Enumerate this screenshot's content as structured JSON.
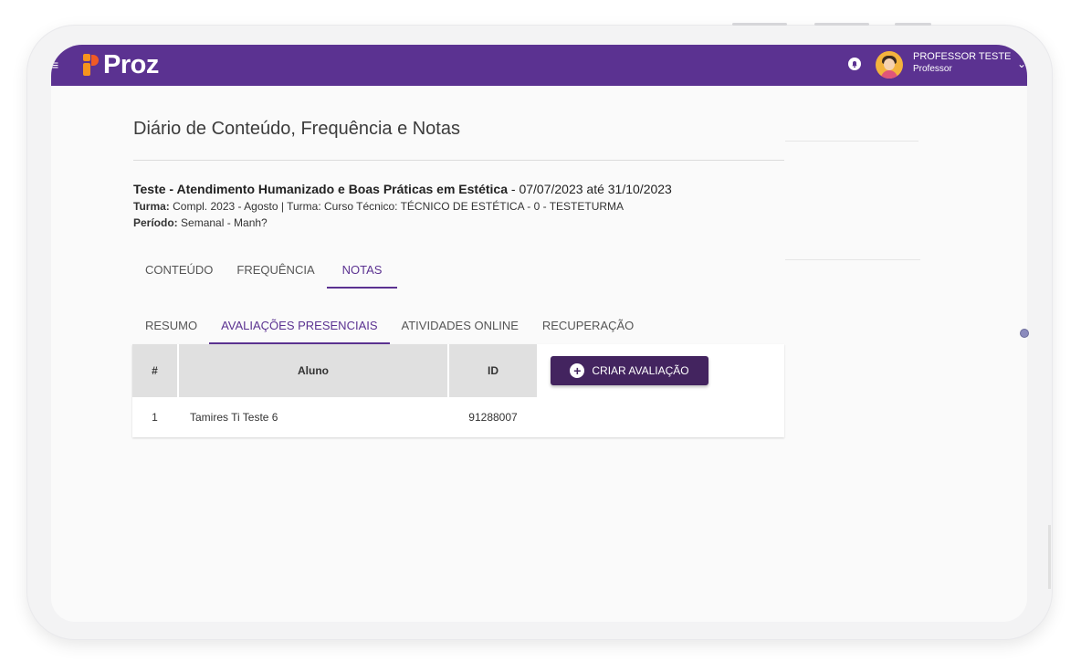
{
  "header": {
    "logo_text": "Proz",
    "user_name": "PROFESSOR TESTE",
    "user_role": "Professor",
    "menu_icon": "menu-icon",
    "notification_icon": "bell-icon",
    "dropdown_icon": "chevron-down-icon"
  },
  "page": {
    "title": "Diário de Conteúdo, Frequência e Notas"
  },
  "course": {
    "name": "Teste - Atendimento Humanizado e Boas Práticas em Estética",
    "dates": "- 07/07/2023 até 31/10/2023",
    "turma_label": "Turma:",
    "turma_value": "Compl. 2023 - Agosto | Turma: Curso Técnico: TÉCNICO DE ESTÉTICA - 0 - TESTETURMA",
    "periodo_label": "Período:",
    "periodo_value": "Semanal - Manh?"
  },
  "tabs": [
    {
      "label": "CONTEÚDO",
      "active": false
    },
    {
      "label": "FREQUÊNCIA",
      "active": false
    },
    {
      "label": "NOTAS",
      "active": true
    }
  ],
  "subtabs": [
    {
      "label": "RESUMO",
      "active": false
    },
    {
      "label": "AVALIAÇÕES PRESENCIAIS",
      "active": true
    },
    {
      "label": "ATIVIDADES ONLINE",
      "active": false
    },
    {
      "label": "RECUPERAÇÃO",
      "active": false
    }
  ],
  "table": {
    "headers": [
      "#",
      "Aluno",
      "ID"
    ],
    "rows": [
      {
        "num": "1",
        "aluno": "Tamires Ti Teste 6",
        "id": "91288007"
      }
    ]
  },
  "actions": {
    "create_label": "CRIAR AVALIAÇÃO"
  },
  "colors": {
    "brand": "#5b3291",
    "button": "#43245f"
  }
}
